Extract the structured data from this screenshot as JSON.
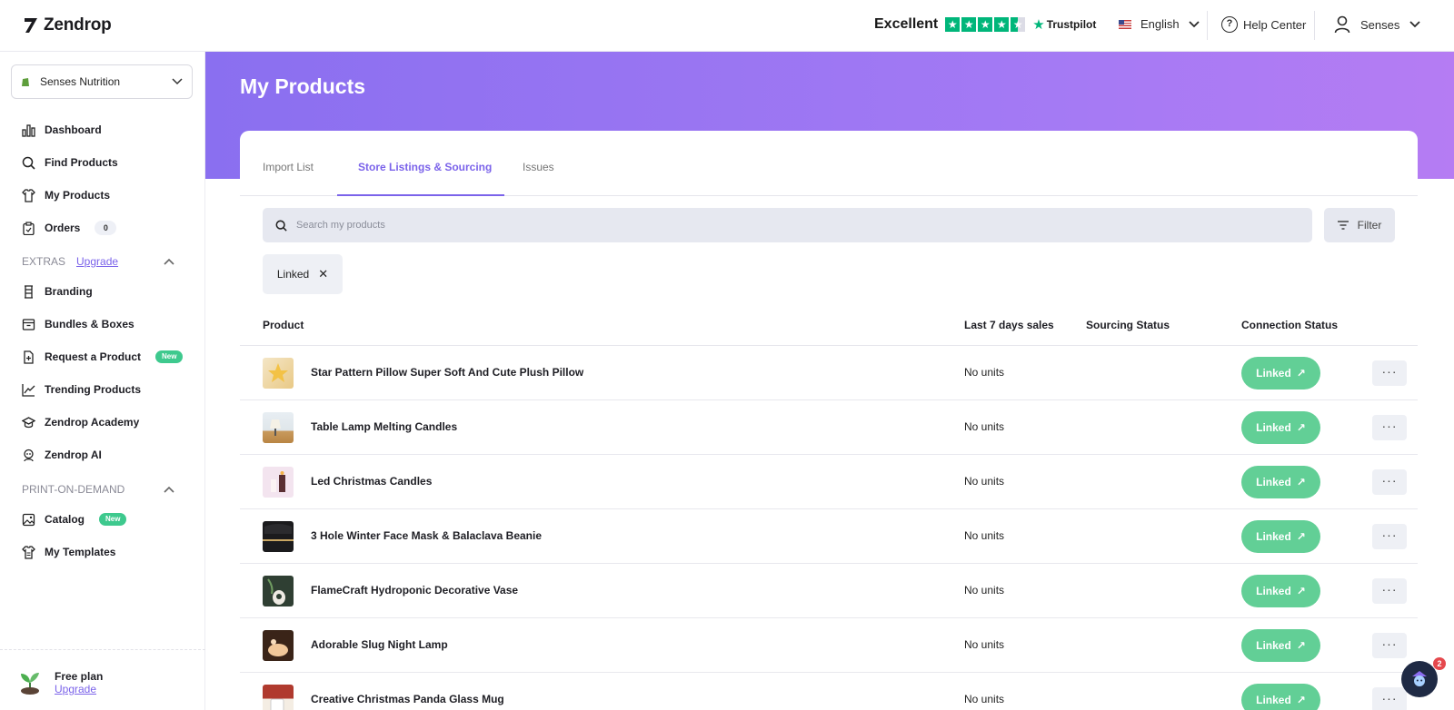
{
  "app": {
    "name": "Zendrop"
  },
  "header": {
    "trustpilot": {
      "rating_word": "Excellent",
      "brand": "Trustpilot"
    },
    "language": "English",
    "help": "Help Center",
    "user": "Senses"
  },
  "sidebar": {
    "store": "Senses Nutrition",
    "items": [
      {
        "label": "Dashboard",
        "icon": "chart-icon"
      },
      {
        "label": "Find Products",
        "icon": "search-icon"
      },
      {
        "label": "My Products",
        "icon": "shirt-icon"
      },
      {
        "label": "Orders",
        "icon": "clipboard-icon",
        "count": "0"
      }
    ],
    "extras": {
      "title": "EXTRAS",
      "upgrade": "Upgrade",
      "items": [
        {
          "label": "Branding",
          "icon": "branding-icon"
        },
        {
          "label": "Bundles & Boxes",
          "icon": "box-icon"
        },
        {
          "label": "Request a Product",
          "icon": "request-icon",
          "badge": "New"
        },
        {
          "label": "Trending Products",
          "icon": "trending-icon"
        },
        {
          "label": "Zendrop Academy",
          "icon": "academy-icon"
        },
        {
          "label": "Zendrop AI",
          "icon": "ai-icon"
        }
      ]
    },
    "pod": {
      "title": "PRINT-ON-DEMAND",
      "items": [
        {
          "label": "Catalog",
          "icon": "image-icon",
          "badge": "New"
        },
        {
          "label": "My Templates",
          "icon": "template-icon"
        }
      ]
    },
    "plan": {
      "title": "Free plan",
      "upgrade": "Upgrade"
    }
  },
  "page": {
    "title": "My Products",
    "tabs": [
      "Import List",
      "Store Listings & Sourcing",
      "Issues"
    ],
    "active_tab": "Store Listings & Sourcing",
    "search_placeholder": "Search my products",
    "filter_label": "Filter",
    "active_filter_chip": "Linked",
    "columns": [
      "Product",
      "Last 7 days sales",
      "Sourcing Status",
      "Connection Status"
    ],
    "rows": [
      {
        "name": "Star Pattern Pillow Super Soft And Cute Plush Pillow",
        "sales": "No units",
        "status": "Linked"
      },
      {
        "name": "Table Lamp Melting Candles",
        "sales": "No units",
        "status": "Linked"
      },
      {
        "name": "Led Christmas Candles",
        "sales": "No units",
        "status": "Linked"
      },
      {
        "name": "3 Hole Winter Face Mask & Balaclava Beanie",
        "sales": "No units",
        "status": "Linked"
      },
      {
        "name": "FlameCraft Hydroponic Decorative Vase",
        "sales": "No units",
        "status": "Linked"
      },
      {
        "name": "Adorable Slug Night Lamp",
        "sales": "No units",
        "status": "Linked"
      },
      {
        "name": "Creative Christmas Panda Glass Mug",
        "sales": "No units",
        "status": "Linked"
      }
    ],
    "more_label": "···"
  },
  "chat": {
    "badge": "2"
  },
  "colors": {
    "accent": "#7b63ea",
    "linked": "#62cf96",
    "trustpilot": "#00b67a"
  }
}
